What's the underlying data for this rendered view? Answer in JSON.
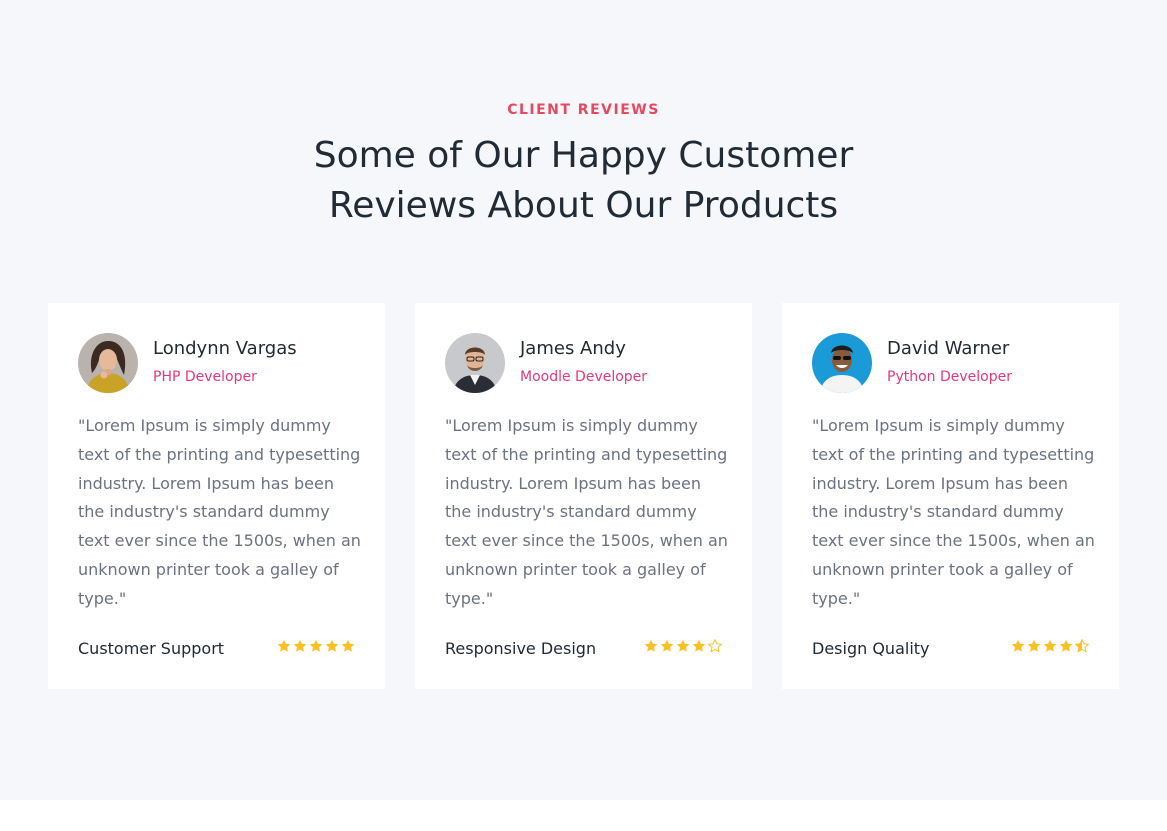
{
  "section": {
    "eyebrow": "CLIENT REVIEWS",
    "heading_line1": "Some of Our Happy Customer",
    "heading_line2": "Reviews About Our Products"
  },
  "colors": {
    "accent": "#e5485f",
    "role": "#e5387a",
    "star": "#fbbf24",
    "background": "#f5f7fb"
  },
  "reviews": [
    {
      "name": "Londynn Vargas",
      "role": "PHP Developer",
      "quote": "\"Lorem Ipsum is simply dummy text of the printing and typesetting industry. Lorem Ipsum has been the industry's standard dummy text ever since the 1500s, when an unknown printer took a galley of type.\"",
      "feature": "Customer Support",
      "rating": 5
    },
    {
      "name": "James Andy",
      "role": "Moodle Developer",
      "quote": "\"Lorem Ipsum is simply dummy text of the printing and typesetting industry. Lorem Ipsum has been the industry's standard dummy text ever since the 1500s, when an unknown printer took a galley of type.\"",
      "feature": "Responsive Design",
      "rating": 4
    },
    {
      "name": "David Warner",
      "role": "Python Developer",
      "quote": "\"Lorem Ipsum is simply dummy text of the printing and typesetting industry. Lorem Ipsum has been the industry's standard dummy text ever since the 1500s, when an unknown printer took a galley of type.\"",
      "feature": "Design Quality",
      "rating": 4.5
    }
  ]
}
